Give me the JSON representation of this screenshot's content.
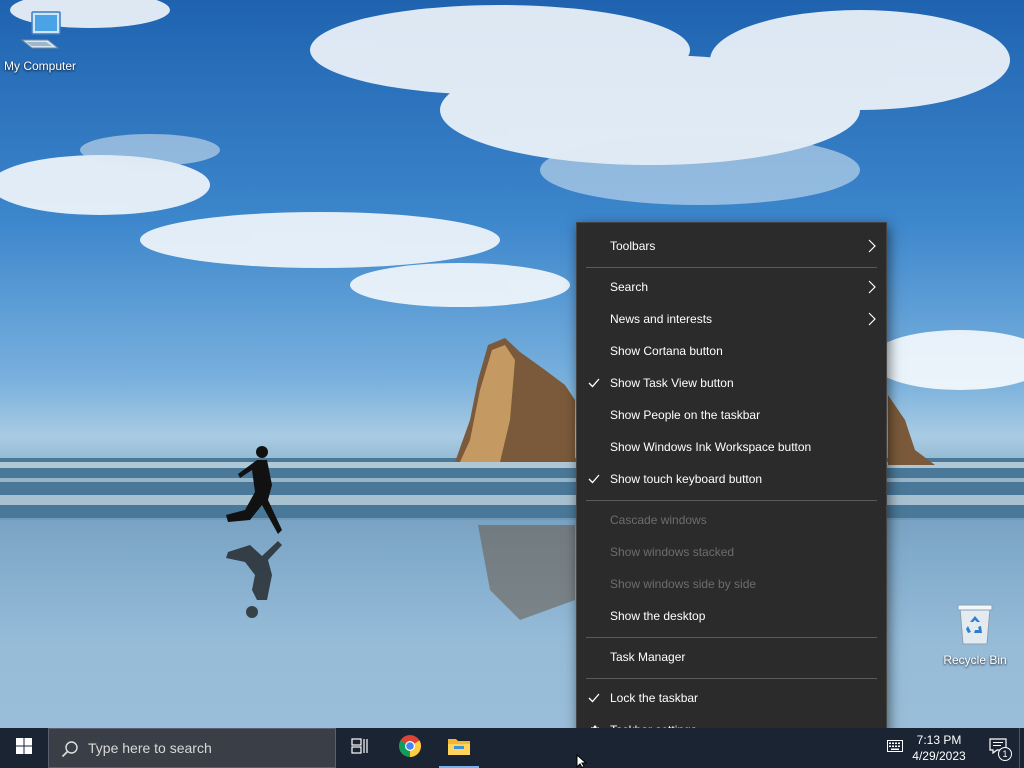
{
  "desktop": {
    "icons": [
      {
        "label": "My Computer"
      },
      {
        "label": "Recycle Bin"
      }
    ]
  },
  "context_menu": {
    "items": [
      {
        "label": "Toolbars",
        "checked": false,
        "submenu": true,
        "disabled": false
      },
      {
        "label": "Search",
        "checked": false,
        "submenu": true,
        "disabled": false
      },
      {
        "label": "News and interests",
        "checked": false,
        "submenu": true,
        "disabled": false
      },
      {
        "label": "Show Cortana button",
        "checked": false,
        "submenu": false,
        "disabled": false
      },
      {
        "label": "Show Task View button",
        "checked": true,
        "submenu": false,
        "disabled": false
      },
      {
        "label": "Show People on the taskbar",
        "checked": false,
        "submenu": false,
        "disabled": false
      },
      {
        "label": "Show Windows Ink Workspace button",
        "checked": false,
        "submenu": false,
        "disabled": false
      },
      {
        "label": "Show touch keyboard button",
        "checked": true,
        "submenu": false,
        "disabled": false
      },
      {
        "label": "Cascade windows",
        "checked": false,
        "submenu": false,
        "disabled": true
      },
      {
        "label": "Show windows stacked",
        "checked": false,
        "submenu": false,
        "disabled": true
      },
      {
        "label": "Show windows side by side",
        "checked": false,
        "submenu": false,
        "disabled": true
      },
      {
        "label": "Show the desktop",
        "checked": false,
        "submenu": false,
        "disabled": false
      },
      {
        "label": "Task Manager",
        "checked": false,
        "submenu": false,
        "disabled": false
      },
      {
        "label": "Lock the taskbar",
        "checked": true,
        "submenu": false,
        "disabled": false
      },
      {
        "label": "Taskbar settings",
        "icon": "gear-icon",
        "checked": false,
        "submenu": false,
        "disabled": false
      }
    ]
  },
  "taskbar": {
    "search_placeholder": "Type here to search",
    "pinned": [
      "task-view-icon",
      "chrome-icon",
      "file-explorer-icon"
    ],
    "clock": {
      "time": "7:13 PM",
      "date": "4/29/2023"
    },
    "notification_count": "1"
  },
  "colors": {
    "menu_bg": "#2b2b2b",
    "menu_text": "#ffffff",
    "menu_disabled_text": "#6d6d6d",
    "taskbar_bg": "#1a2433",
    "accent": "#77b2f0"
  }
}
